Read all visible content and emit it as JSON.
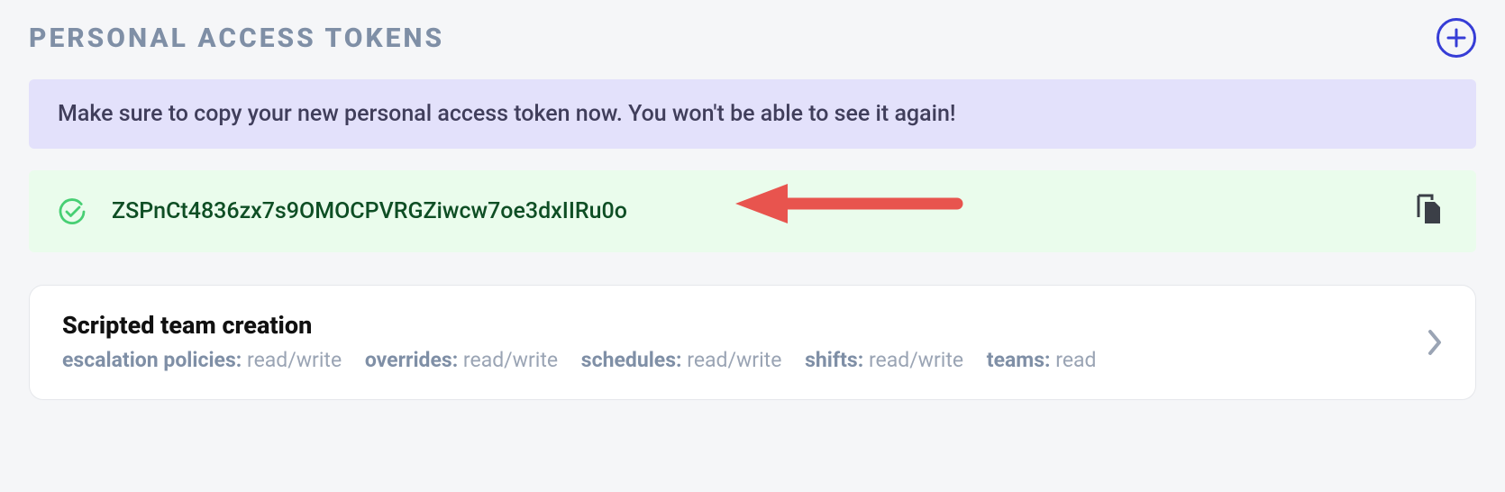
{
  "header": {
    "title": "PERSONAL ACCESS TOKENS"
  },
  "banner": {
    "message": "Make sure to copy your new personal access token now. You won't be able to see it again!"
  },
  "new_token": {
    "value": "ZSPnCt4836zx7s9OMOCPVRGZiwcw7oe3dxIIRu0o"
  },
  "tokens": [
    {
      "name": "Scripted team creation",
      "scopes": [
        {
          "key": "escalation policies",
          "value": "read/write"
        },
        {
          "key": "overrides",
          "value": "read/write"
        },
        {
          "key": "schedules",
          "value": "read/write"
        },
        {
          "key": "shifts",
          "value": "read/write"
        },
        {
          "key": "teams",
          "value": "read"
        }
      ]
    }
  ]
}
